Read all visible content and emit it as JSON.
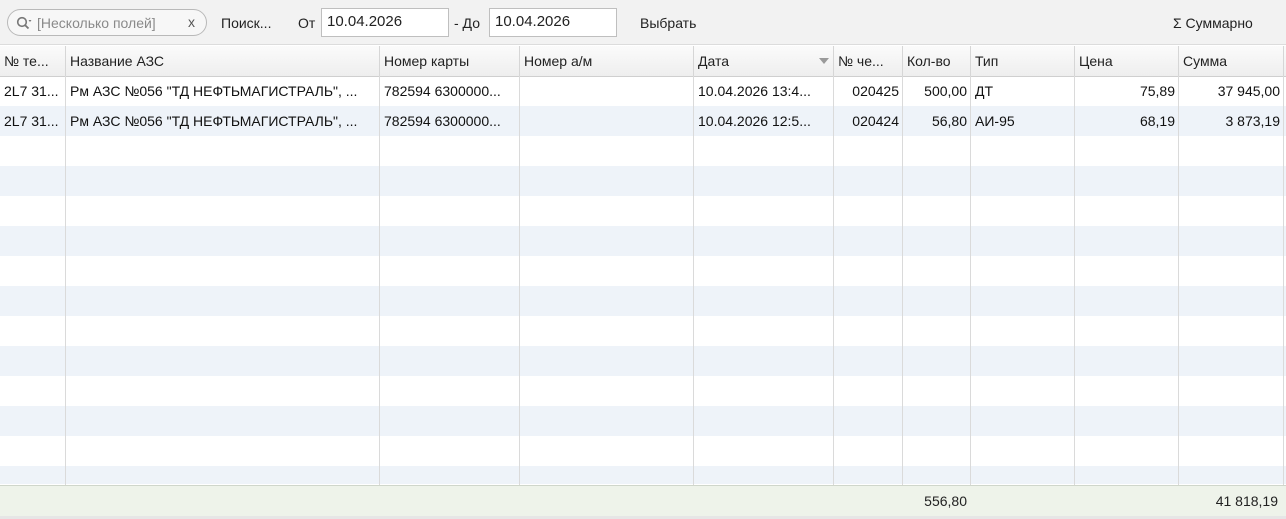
{
  "toolbar": {
    "search_placeholder": "[Несколько полей]",
    "clear_label": "x",
    "search_label": "Поиск...",
    "from_label": "От",
    "from_date": "10.04.2026",
    "to_label": "- До",
    "to_date": "10.04.2026",
    "select_label": "Выбрать",
    "summary_label": "Σ Суммарно"
  },
  "table": {
    "columns": [
      "№ те...",
      "Название АЗС",
      "Номер карты",
      "Номер а/м",
      "Дата",
      "№ че...",
      "Кол-во",
      "Тип",
      "Цена",
      "Сумма"
    ],
    "sorted_column": "Дата",
    "rows": [
      [
        "2L7 31...",
        "Рм АЗС №056 \"ТД НЕФТЬМАГИСТРАЛЬ\", ...",
        "782594 6300000...",
        "",
        "10.04.2026 13:4...",
        "020425",
        "500,00",
        "ДТ",
        "75,89",
        "37 945,00"
      ],
      [
        "2L7 31...",
        "Рм АЗС №056 \"ТД НЕФТЬМАГИСТРАЛЬ\", ...",
        "782594 6300000...",
        "",
        "10.04.2026 12:5...",
        "020424",
        "56,80",
        "АИ-95",
        "68,19",
        "3 873,19"
      ]
    ],
    "totals": {
      "quantity": "556,80",
      "sum": "41 818,19"
    }
  }
}
